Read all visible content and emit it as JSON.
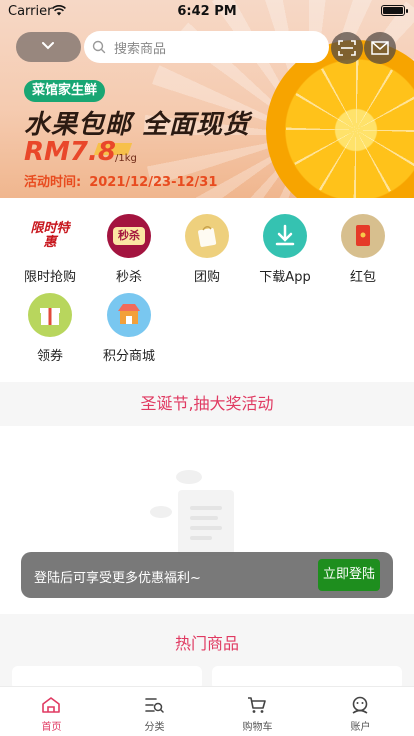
{
  "status_bar": {
    "carrier": "Carrier",
    "time": "6:42 PM"
  },
  "search": {
    "placeholder": "搜索商品"
  },
  "banner": {
    "tag": "菜馆家生鲜",
    "headline": "水果包邮 全面现货",
    "price": "RM7.8",
    "unit": "/1kg",
    "activity_label": "活动时间:",
    "activity_dates": "2021/12/23-12/31"
  },
  "grid": [
    {
      "label": "限时抢购",
      "icon": "limited-sale-icon",
      "badge": "限时特惠"
    },
    {
      "label": "秒杀",
      "icon": "flash-kill-icon",
      "badge": "秒杀"
    },
    {
      "label": "团购",
      "icon": "group-buy-icon"
    },
    {
      "label": "下载App",
      "icon": "download-icon"
    },
    {
      "label": "红包",
      "icon": "red-packet-icon"
    },
    {
      "label": "领券",
      "icon": "coupon-gift-icon"
    },
    {
      "label": "积分商城",
      "icon": "points-shop-icon"
    }
  ],
  "promo": {
    "text": "圣诞节,抽大奖活动"
  },
  "toast": {
    "text": "登陆后可享受更多优惠福利~",
    "button": "立即登陆"
  },
  "hot": {
    "title": "热门商品"
  },
  "tabs": [
    {
      "label": "首页",
      "icon": "home-icon",
      "active": true
    },
    {
      "label": "分类",
      "icon": "category-icon",
      "active": false
    },
    {
      "label": "购物车",
      "icon": "cart-icon",
      "active": false
    },
    {
      "label": "账户",
      "icon": "account-icon",
      "active": false
    }
  ],
  "colors": {
    "accent": "#e03a62",
    "login_button": "#1e8e1e",
    "price": "#e9472a"
  }
}
